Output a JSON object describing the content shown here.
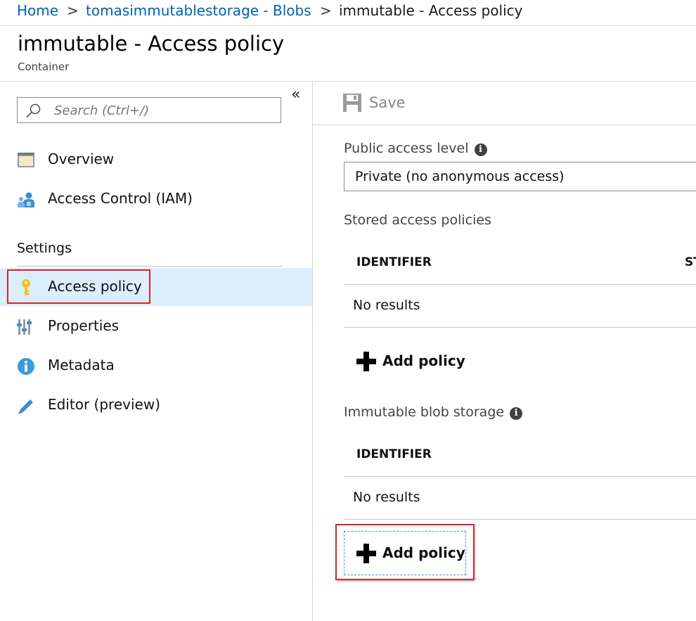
{
  "breadcrumb": {
    "items": [
      "Home",
      "tomasimmutablestorage - Blobs",
      "immutable - Access policy"
    ],
    "separator": ">"
  },
  "page": {
    "title": "immutable - Access policy",
    "subtitle": "Container"
  },
  "sidebar": {
    "collapse_glyph": "«",
    "search": {
      "placeholder": "Search (Ctrl+/)",
      "value": ""
    },
    "items": [
      {
        "label": "Overview",
        "icon": "overview-icon"
      },
      {
        "label": "Access Control (IAM)",
        "icon": "iam-icon"
      }
    ],
    "settings_label": "Settings",
    "settings_items": [
      {
        "label": "Access policy",
        "icon": "key-icon",
        "active": true
      },
      {
        "label": "Properties",
        "icon": "properties-icon"
      },
      {
        "label": "Metadata",
        "icon": "info-icon"
      },
      {
        "label": "Editor (preview)",
        "icon": "pencil-icon"
      }
    ]
  },
  "toolbar": {
    "save_label": "Save",
    "save_icon": "save-icon"
  },
  "main": {
    "public_access": {
      "label": "Public access level",
      "selected": "Private (no anonymous access)"
    },
    "stored_policies": {
      "label": "Stored access policies",
      "columns": [
        "IDENTIFIER",
        "ST"
      ],
      "empty_text": "No results",
      "add_label": "Add policy"
    },
    "immutable_storage": {
      "label": "Immutable blob storage",
      "columns": [
        "IDENTIFIER"
      ],
      "empty_text": "No results",
      "add_label": "Add policy"
    }
  },
  "colors": {
    "link": "#0063b1",
    "active_bg": "#daeefc",
    "highlight_red": "#d9242b",
    "key_yellow": "#f0c419"
  }
}
